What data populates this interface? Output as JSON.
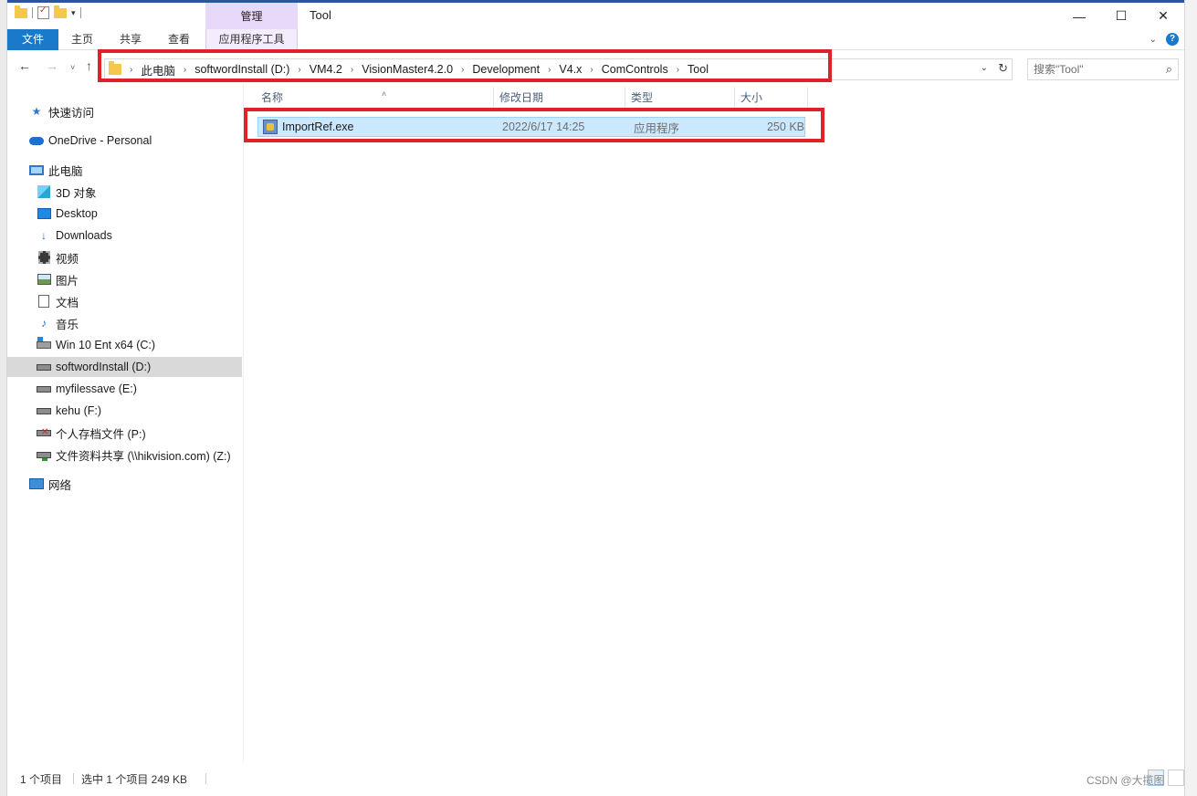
{
  "window": {
    "title": "Tool",
    "contextual_group": "管理",
    "controls": {
      "minimize": "—",
      "maximize": "☐",
      "close": "✕"
    }
  },
  "ribbon": {
    "tabs": [
      {
        "label": "文件"
      },
      {
        "label": "主页"
      },
      {
        "label": "共享"
      },
      {
        "label": "查看"
      },
      {
        "label": "应用程序工具"
      }
    ]
  },
  "nav": {
    "back": "←",
    "forward": "→",
    "recent": "˅",
    "up": "↑",
    "breadcrumbs": [
      "此电脑",
      "softwordInstall (D:)",
      "VM4.2",
      "VisionMaster4.2.0",
      "Development",
      "V4.x",
      "ComControls",
      "Tool"
    ],
    "search_placeholder": "搜索\"Tool\""
  },
  "sidebar": {
    "items": [
      {
        "label": "快速访问",
        "icon": "star-icon"
      },
      {
        "label": "OneDrive - Personal",
        "icon": "cloud-icon"
      },
      {
        "label": "此电脑",
        "icon": "computer-icon"
      },
      {
        "label": "3D 对象",
        "icon": "cube-icon"
      },
      {
        "label": "Desktop",
        "icon": "desktop-icon"
      },
      {
        "label": "Downloads",
        "icon": "download-icon"
      },
      {
        "label": "视频",
        "icon": "video-icon"
      },
      {
        "label": "图片",
        "icon": "picture-icon"
      },
      {
        "label": "文档",
        "icon": "document-icon"
      },
      {
        "label": "音乐",
        "icon": "music-icon"
      },
      {
        "label": "Win 10 Ent x64 (C:)",
        "icon": "system-drive-icon"
      },
      {
        "label": "softwordInstall (D:)",
        "icon": "drive-icon",
        "selected": true
      },
      {
        "label": "myfilessave (E:)",
        "icon": "drive-icon"
      },
      {
        "label": "kehu (F:)",
        "icon": "drive-icon"
      },
      {
        "label": "个人存档文件 (P:)",
        "icon": "disconnected-network-drive-icon"
      },
      {
        "label": "文件资料共享 (\\\\hikvision.com) (Z:)",
        "icon": "network-drive-icon"
      },
      {
        "label": "网络",
        "icon": "network-icon"
      }
    ]
  },
  "filelist": {
    "columns": [
      "名称",
      "修改日期",
      "类型",
      "大小"
    ],
    "rows": [
      {
        "name": "ImportRef.exe",
        "date": "2022/6/17 14:25",
        "type": "应用程序",
        "size": "250 KB",
        "selected": true
      }
    ]
  },
  "status": {
    "count": "1 个项目",
    "selection": "选中 1 个项目  249 KB"
  },
  "watermark": "CSDN @大揽图",
  "colors": {
    "highlight_red": "#e0202a",
    "selection_blue": "#cce8ff",
    "file_tab_blue": "#1979ca",
    "manage_purple": "#e8d8fa"
  }
}
